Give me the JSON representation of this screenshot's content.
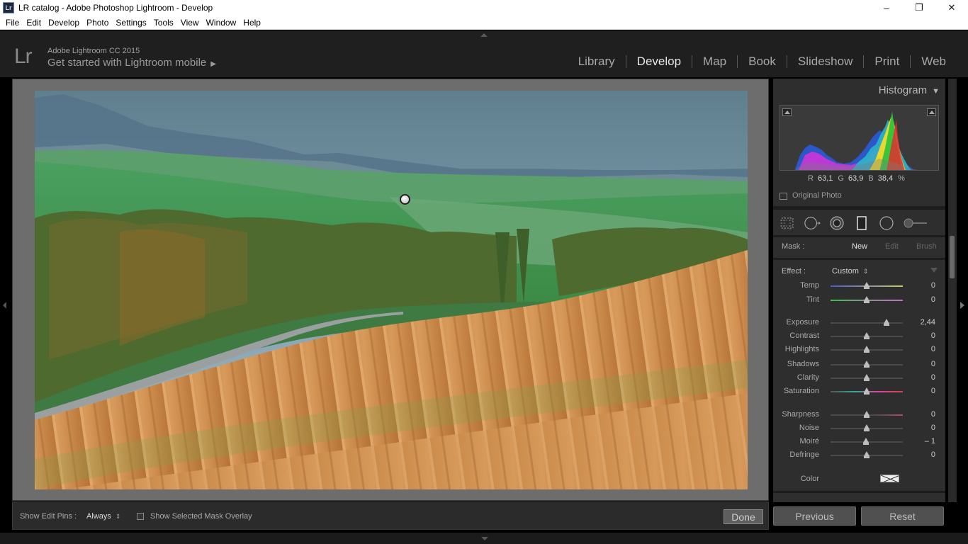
{
  "window": {
    "title": "LR catalog - Adobe Photoshop Lightroom - Develop",
    "icon_text": "Lr",
    "minimize": "–",
    "restore": "❐",
    "close": "✕"
  },
  "menu": [
    "File",
    "Edit",
    "Develop",
    "Photo",
    "Settings",
    "Tools",
    "View",
    "Window",
    "Help"
  ],
  "identity": {
    "logo": "Lr",
    "version": "Adobe Lightroom CC 2015",
    "mobile": "Get started with Lightroom mobile",
    "mobile_arrow": "▶"
  },
  "modules": [
    "Library",
    "Develop",
    "Map",
    "Book",
    "Slideshow",
    "Print",
    "Web"
  ],
  "active_module": "Develop",
  "toolbar": {
    "edit_pins_label": "Show Edit Pins :",
    "edit_pins_value": "Always",
    "updown": "⇕",
    "overlay_label": "Show Selected Mask Overlay",
    "done": "Done"
  },
  "histogram": {
    "title": "Histogram",
    "title_arrow": "▼",
    "r_label": "R",
    "r_value": "63,1",
    "g_label": "G",
    "g_value": "63,9",
    "b_label": "B",
    "b_value": "38,4",
    "percent": "%",
    "original_photo": "Original Photo"
  },
  "mask": {
    "label": "Mask :",
    "new": "New",
    "edit": "Edit",
    "brush": "Brush"
  },
  "effect": {
    "label": "Effect :",
    "value": "Custom",
    "updown": "⇕"
  },
  "sliders": {
    "temp": {
      "label": "Temp",
      "value": "0",
      "pos": 0.5
    },
    "tint": {
      "label": "Tint",
      "value": "0",
      "pos": 0.5
    },
    "exposure": {
      "label": "Exposure",
      "value": "2,44",
      "pos": 0.77
    },
    "contrast": {
      "label": "Contrast",
      "value": "0",
      "pos": 0.5
    },
    "highlights": {
      "label": "Highlights",
      "value": "0",
      "pos": 0.5
    },
    "shadows": {
      "label": "Shadows",
      "value": "0",
      "pos": 0.5
    },
    "clarity": {
      "label": "Clarity",
      "value": "0",
      "pos": 0.5
    },
    "saturation": {
      "label": "Saturation",
      "value": "0",
      "pos": 0.5
    },
    "sharpness": {
      "label": "Sharpness",
      "value": "0",
      "pos": 0.5
    },
    "noise": {
      "label": "Noise",
      "value": "0",
      "pos": 0.5
    },
    "moire": {
      "label": "Moiré",
      "value": "– 1",
      "pos": 0.495
    },
    "defringe": {
      "label": "Defringe",
      "value": "0",
      "pos": 0.5
    }
  },
  "color_label": "Color",
  "buttons": {
    "previous": "Previous",
    "reset": "Reset"
  },
  "colors": {
    "panel_bg": "#2e2e2e",
    "canvas_bg": "#6d6d6d",
    "active_text": "#e8e8e8"
  }
}
